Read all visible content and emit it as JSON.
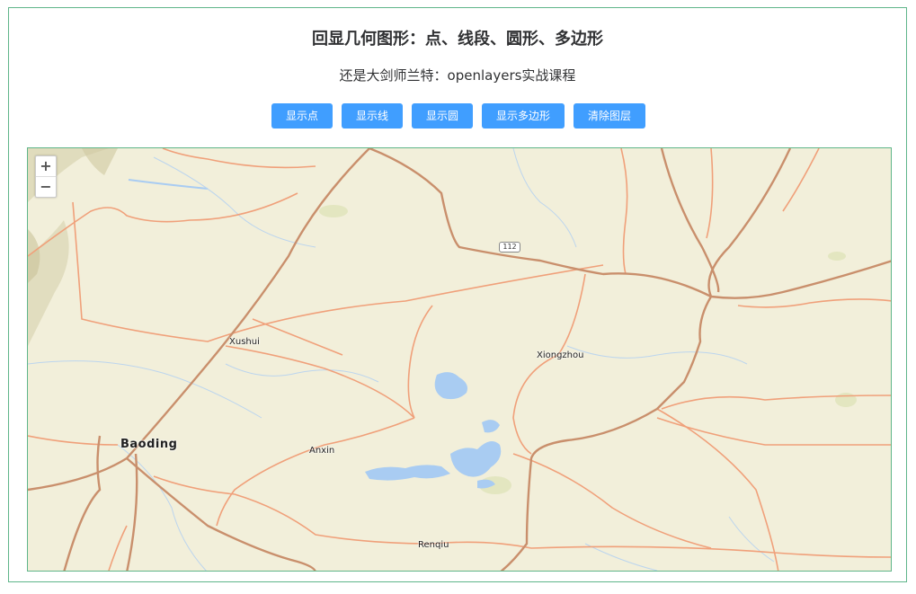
{
  "page": {
    "title": "回显几何图形：点、线段、圆形、多边形",
    "subtitle": "还是大剑师兰特：openlayers实战课程"
  },
  "buttons": [
    {
      "label": "显示点"
    },
    {
      "label": "显示线"
    },
    {
      "label": "显示圆"
    },
    {
      "label": "显示多边形"
    },
    {
      "label": "清除图层"
    }
  ],
  "map": {
    "zoom_in": "+",
    "zoom_out": "−",
    "road_shield": "112",
    "places": {
      "xushui": "Xushui",
      "xiongzhou": "Xiongzhou",
      "baoding": "Baoding",
      "anxin": "Anxin",
      "renqiu": "Renqiu"
    }
  },
  "colors": {
    "accent": "#409eff",
    "border": "#5fb58a",
    "land": "#f2efda",
    "road_major": "#c98f6c",
    "road_minor": "#f0a07a",
    "water": "#a9ccf2"
  }
}
